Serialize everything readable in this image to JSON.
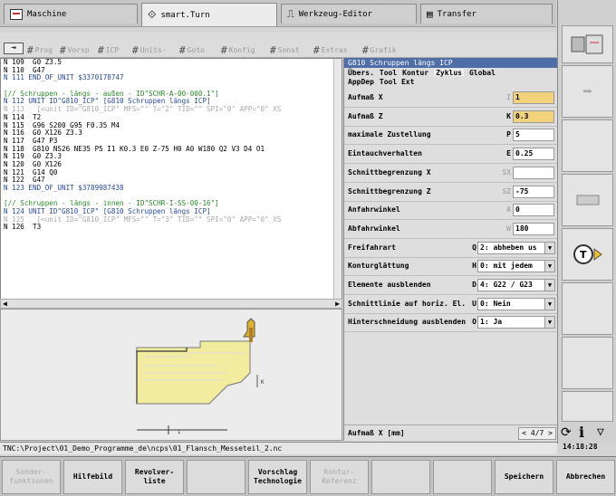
{
  "tabs": [
    {
      "label": "Maschine"
    },
    {
      "label": "smart.Turn"
    },
    {
      "label": "Werkzeug-Editor"
    },
    {
      "label": "Transfer"
    }
  ],
  "menubar": [
    "Prog",
    "Vorsp",
    "ICP",
    "Units-",
    "Goto",
    "Konfig",
    "Sonst",
    "Extras",
    "Grafik"
  ],
  "editor": {
    "lines": [
      "N 109  G0 Z3.5",
      "N 110  G47",
      "N 111 END_OF_UNIT $3370178747",
      "",
      "[// Schruppen - längs - außen - ID\"SCHR-A-00-000.1\"]",
      "N 112 UNIT ID\"G810_ICP\" [G810 Schruppen längs ICP]",
      "N 113   [<unit ID=\"G810_ICP\" MFS=\"\" T=\"2\" TID=\"\" SPI=\"0\" APP=\"0\" XS",
      "N 114  T2",
      "N 115  G96 S200 G95 F0.35 M4",
      "N 116  G0 X126 Z3.3",
      "N 117  G47 P3",
      "N 118  G810 NS26 NE35 P5 I1 K0.3 E0 Z-75 H0 A0 W180 Q2 V3 D4 O1",
      "N 119  G0 Z3.3",
      "N 120  G0 X126",
      "N 121  G14 Q0",
      "N 122  G47",
      "N 123 END_OF_UNIT $3789987438",
      "",
      "[// Schruppen - längs - innen - ID\"SCHR-I-SS-00-16\"]",
      "N 124 UNIT ID\"G810_ICP\" [G810 Schruppen längs ICP]",
      "N 125   [<unit ID=\"G810_ICP\" MFS=\"\" T=\"3\" TID=\"\" SPI=\"0\" APP=\"0\" XS",
      "N 126  T3"
    ]
  },
  "dialog": {
    "title": "G810 Schruppen längs ICP",
    "tabs_row1": [
      "Übers.",
      "Tool",
      "Kontur",
      "Zyklus",
      "Global"
    ],
    "tabs_row2": [
      "AppDep",
      "Tool Ext"
    ],
    "params": [
      {
        "label": "Aufmaß X",
        "sym": "I",
        "value": "1"
      },
      {
        "label": "Aufmaß Z",
        "sym": "K",
        "value": "0.3"
      },
      {
        "label": "maximale Zustellung",
        "sym": "P",
        "value": "5"
      },
      {
        "label": "Eintauchverhalten",
        "sym": "E",
        "value": "0.25"
      },
      {
        "label": "Schnittbegrenzung X",
        "sym": "SX",
        "value": ""
      },
      {
        "label": "Schnittbegrenzung Z",
        "sym": "SZ",
        "value": "-75"
      },
      {
        "label": "Anfahrwinkel",
        "sym": "A",
        "value": "0"
      },
      {
        "label": "Abfahrwinkel",
        "sym": "W",
        "value": "180"
      },
      {
        "label": "Freifahrart",
        "sym": "Q",
        "value": "2: abheben us"
      },
      {
        "label": "Konturglättung",
        "sym": "H",
        "value": "0: mit jedem"
      },
      {
        "label": "Elemente ausblenden",
        "sym": "D",
        "value": "4: G22 / G23"
      },
      {
        "label": "Schnittlinie auf horiz. El.",
        "sym": "U",
        "value": "0: Nein"
      },
      {
        "label": "Hinterschneidung ausblenden",
        "sym": "O",
        "value": "1: Ja"
      }
    ],
    "status_label": "Aufmaß X [mm]",
    "page": "< 4/7 >"
  },
  "path": "TNC:\\Project\\01_Demo_Programme_de\\ncps\\01_Flansch_Messeteil_2.nc",
  "clock": "14:18:28",
  "softkeys": [
    "Sonder-\nfunktionen",
    "Hilfebild",
    "Revolver-\nliste",
    "",
    "Vorschlag\nTechnologie",
    "Kontur-\nReferenz",
    "",
    "",
    "Speichern",
    "Abbrechen"
  ],
  "colors": {
    "highlight": "#f2d27a",
    "title_bar": "#4f6ea8",
    "comment": "#2a8a2a"
  }
}
